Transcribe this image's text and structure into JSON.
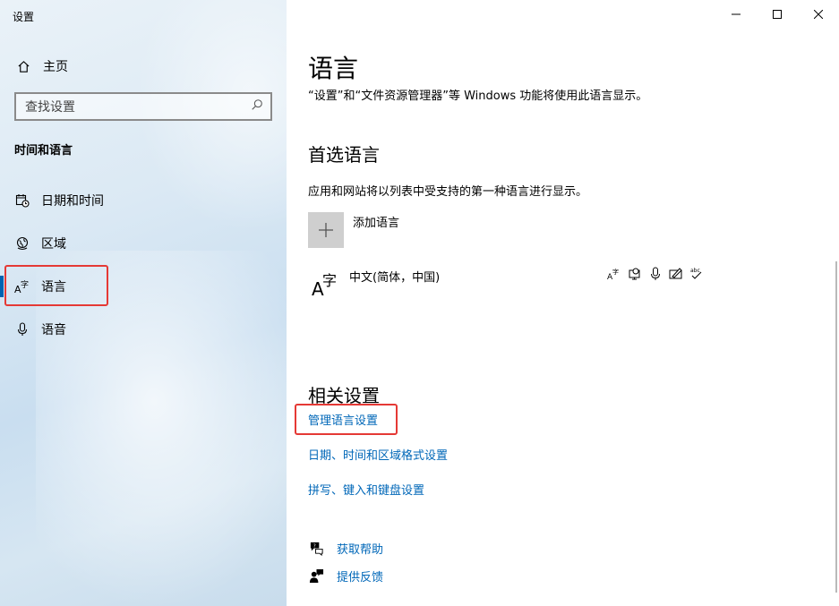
{
  "window": {
    "title": "设置"
  },
  "sidebar": {
    "home_label": "主页",
    "search_placeholder": "查找设置",
    "section_title": "时间和语言",
    "items": [
      {
        "label": "日期和时间",
        "icon": "calendar-clock-icon"
      },
      {
        "label": "区域",
        "icon": "globe-icon"
      },
      {
        "label": "语言",
        "icon": "language-icon",
        "active": true
      },
      {
        "label": "语音",
        "icon": "microphone-icon"
      }
    ]
  },
  "main": {
    "title": "语言",
    "description": "“设置”和“文件资源管理器”等 Windows 功能将使用此语言显示。",
    "preferred": {
      "heading": "首选语言",
      "description": "应用和网站将以列表中受支持的第一种语言进行显示。",
      "add_label": "添加语言",
      "languages": [
        {
          "name": "中文(简体，中国)",
          "glyph_a": "A",
          "glyph_zi": "字"
        }
      ],
      "feature_icons": [
        "display-language-icon",
        "speech-recognition-icon",
        "microphone-icon",
        "handwriting-icon",
        "spell-check-icon"
      ],
      "spell_icon_text": "abc"
    },
    "related": {
      "heading": "相关设置",
      "links": [
        "管理语言设置",
        "日期、时间和区域格式设置",
        "拼写、键入和键盘设置"
      ]
    },
    "help": {
      "get_help": "获取帮助",
      "feedback": "提供反馈"
    }
  },
  "colors": {
    "accent": "#0067b8",
    "highlight": "#e53935",
    "active_bar": "#0063b1"
  }
}
